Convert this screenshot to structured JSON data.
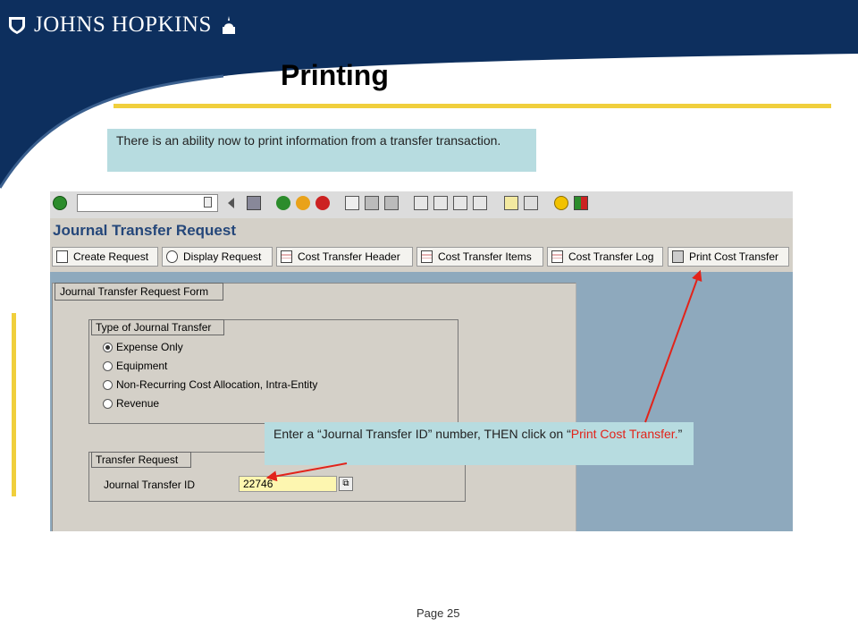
{
  "brand": {
    "name": "JOHNS HOPKINS",
    "navy": "#0d2f5e",
    "gold": "#f0cf3c"
  },
  "slide": {
    "title": "Printing",
    "intro": "There is an ability now to print information from a transfer transaction.",
    "hint_part1": "Enter a “Journal Transfer ID” number, THEN click on “",
    "hint_highlight": "Print Cost Transfer.",
    "hint_part2": "”",
    "page": "Page 25"
  },
  "sap": {
    "toolbar_icons": [
      "check-icon",
      "dropdown-icon",
      "back-nav-icon",
      "save-icon",
      "back-icon",
      "exit-icon",
      "cancel-icon",
      "print-icon",
      "find-icon",
      "find-next-icon",
      "first-page-icon",
      "previous-page-icon",
      "next-page-icon",
      "last-page-icon",
      "create-session-icon",
      "shortcut-icon",
      "help-icon",
      "layout-icon"
    ],
    "screen_title": "Journal Transfer Request",
    "app_buttons": [
      {
        "label": "Create Request",
        "icon": "document-icon"
      },
      {
        "label": "Display Request",
        "icon": "glasses-icon"
      },
      {
        "label": "Cost Transfer Header",
        "icon": "table-icon"
      },
      {
        "label": "Cost Transfer Items",
        "icon": "table-icon"
      },
      {
        "label": "Cost Transfer Log",
        "icon": "table-icon"
      },
      {
        "label": "Print Cost Transfer",
        "icon": "printer-icon"
      }
    ],
    "form_title": "Journal Transfer Request Form",
    "type_group": {
      "label": "Type of Journal Transfer",
      "options": [
        "Expense Only",
        "Equipment",
        "Non-Recurring Cost Allocation, Intra-Entity",
        "Revenue"
      ],
      "selected": "Expense Only"
    },
    "request_group": {
      "label": "Transfer Request",
      "field_label": "Journal Transfer ID",
      "field_value": "22746"
    }
  }
}
